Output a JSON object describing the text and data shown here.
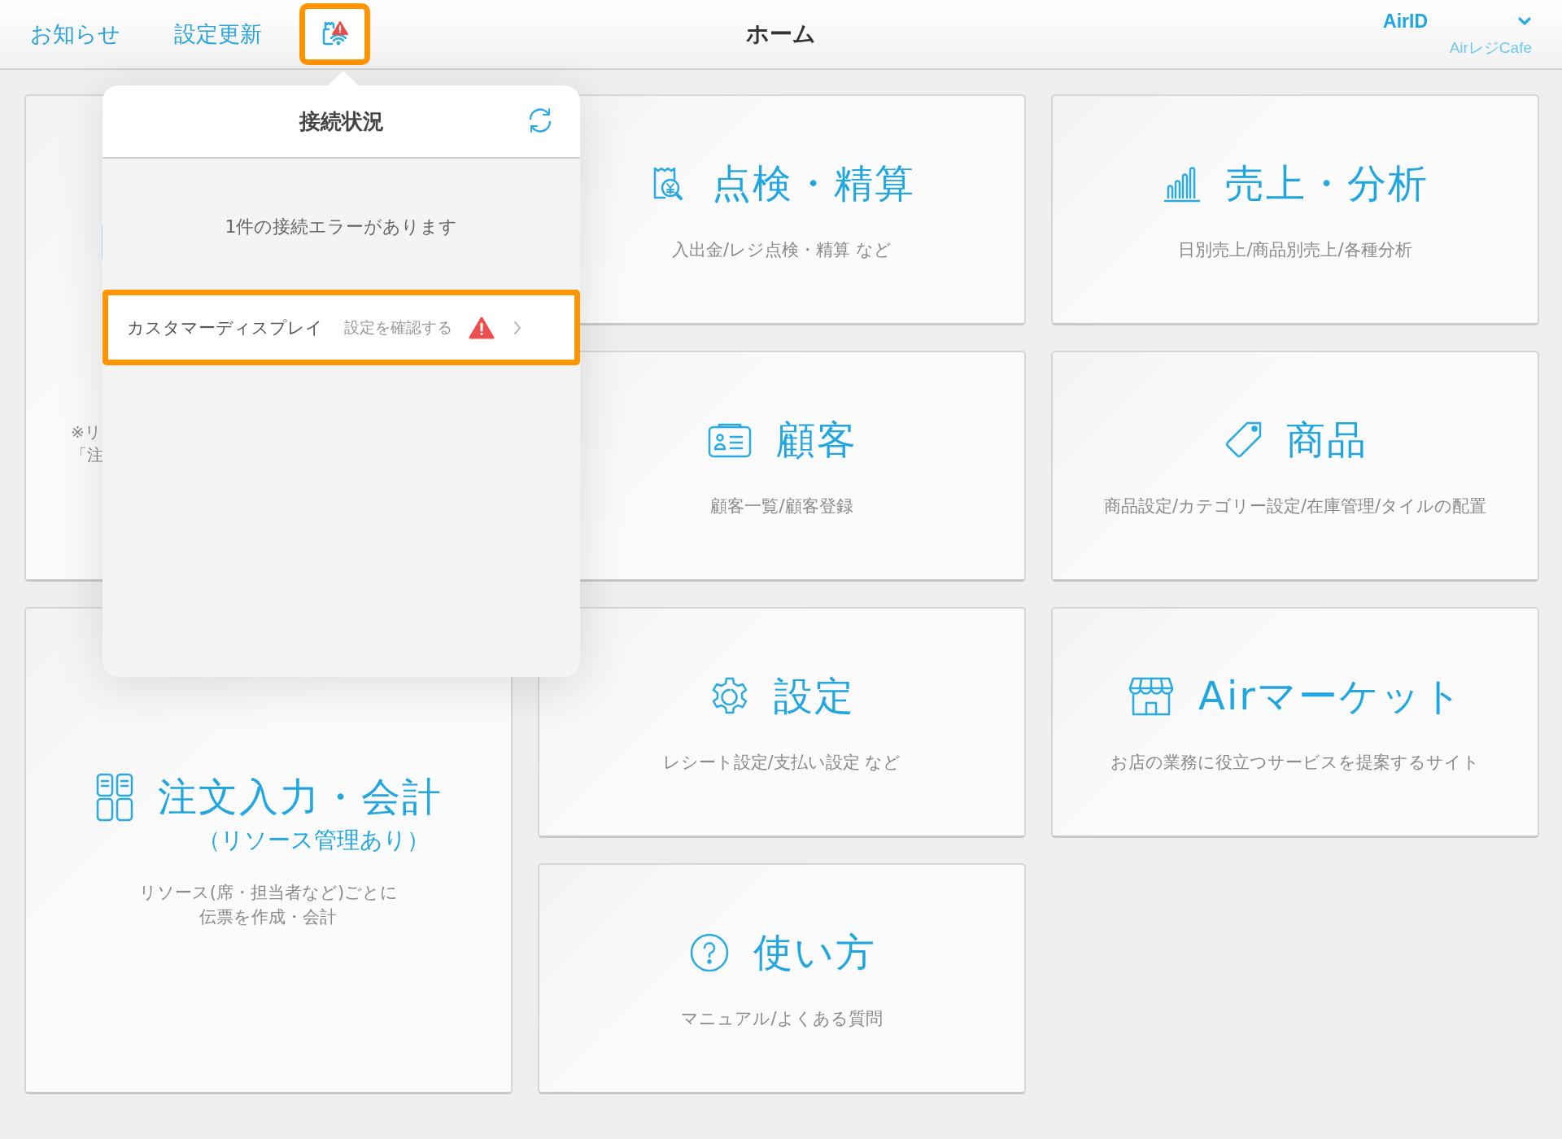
{
  "header": {
    "links": [
      "お知らせ",
      "設定更新"
    ],
    "status_alert": true,
    "title": "ホーム",
    "account": {
      "label": "AirID",
      "store": "AirレジCafe"
    }
  },
  "tiles": [
    {
      "kind": "tall",
      "note": [
        "※リ",
        "「注"
      ]
    },
    {
      "kind": "normal",
      "title": "点検・精算",
      "subtitle": [
        "入出金/レジ点検・精算 など"
      ]
    },
    {
      "kind": "normal",
      "title": "売上・分析",
      "subtitle": [
        "日別売上/商品別売上/各種分析"
      ]
    },
    {
      "kind": "normal",
      "title": "顧客",
      "subtitle": [
        "顧客一覧/顧客登録"
      ]
    },
    {
      "kind": "normal",
      "title": "商品",
      "subtitle": [
        "商品設定/カテゴリー設定/在庫管理/タイルの配置"
      ]
    },
    {
      "kind": "tall",
      "title": "注文入力・会計",
      "title_sub": "（リソース管理あり）",
      "subtitle": [
        "リソース(席・担当者など)ごとに",
        "伝票を作成・会計"
      ]
    },
    {
      "kind": "normal",
      "title": "設定",
      "subtitle": [
        "レシート設定/支払い設定 など"
      ]
    },
    {
      "kind": "normal",
      "title": "Airマーケット",
      "subtitle": [
        "お店の業務に役立つサービスを提案するサイト"
      ]
    },
    {
      "kind": "normal",
      "title": "使い方",
      "subtitle": [
        "マニュアル/よくある質問"
      ]
    }
  ],
  "popover": {
    "title": "接続状況",
    "message": "1件の接続エラーがあります",
    "errors": [
      {
        "device": "カスタマーディスプレイ",
        "action": "設定を確認する",
        "highlighted": true
      }
    ]
  }
}
